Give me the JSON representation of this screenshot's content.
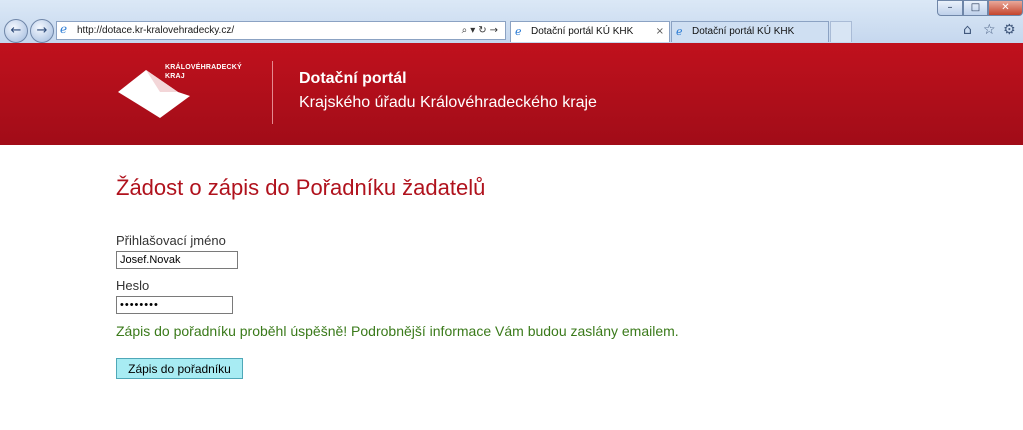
{
  "browser": {
    "url": "http://dotace.kr-kralovehradecky.cz/",
    "tabs": [
      {
        "label": "Dotační portál KÚ KHK",
        "active": true
      },
      {
        "label": "Dotační portál KÚ KHK",
        "active": false
      }
    ],
    "tab_close": "×",
    "icons": {
      "back": "back-arrow-icon",
      "forward": "forward-arrow-icon",
      "site": "ie-page-icon",
      "search": "search-icon",
      "home": "home-icon",
      "favorites": "star-icon",
      "tools": "gear-icon"
    },
    "window_controls": {
      "minimize": "–",
      "maximize": "□",
      "close": "✕"
    }
  },
  "header": {
    "logo_line1": "KRÁLOVÉHRADECKÝ",
    "logo_line2": "KRAJ",
    "title": "Dotační portál",
    "subtitle": "Krajského úřadu Královéhradeckého kraje",
    "color": "#b3101b"
  },
  "form": {
    "title": "Žádost o zápis do Pořadníku žadatelů",
    "username_label": "Přihlašovací jméno",
    "username_value": "Josef.Novak",
    "password_label": "Heslo",
    "password_value": "••••••••",
    "success_message": "Zápis do pořadníku proběhl úspěšně! Podrobnější informace Vám budou zaslány emailem.",
    "submit_label": "Zápis do pořadníku"
  }
}
